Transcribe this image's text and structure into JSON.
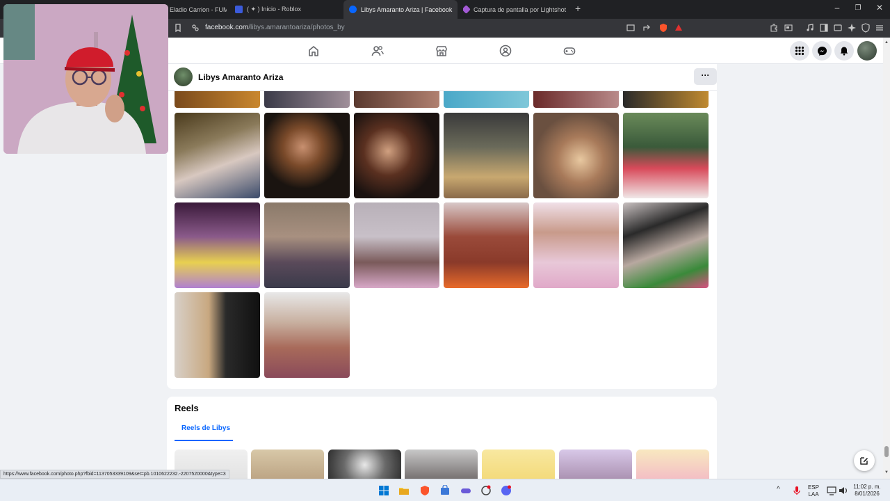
{
  "browser": {
    "tabs": [
      {
        "title": "Eladio Carrion - FUM",
        "active": false
      },
      {
        "title": "( ✦ ) Inicio - Roblox",
        "active": false
      },
      {
        "title": "Libys Amaranto Ariza | Facebook",
        "active": true
      },
      {
        "title": "Captura de pantalla por Lightshot",
        "active": false
      }
    ],
    "url_host": "facebook.com",
    "url_path": "/libys.amarantoariza/photos_by"
  },
  "profile": {
    "name": "Libys Amaranto Ariza",
    "more_label": "···"
  },
  "reels": {
    "section_title": "Reels",
    "tab_label": "Reels de Libys"
  },
  "status_url": "https://www.facebook.com/photo.php?fbid=1137053339109&set=pb.1010622232.-2207520000&type=3",
  "taskbar": {
    "lang_line1": "ESP",
    "lang_line2": "LAA",
    "time": "11:02 p. m.",
    "date": "8/01/2026"
  },
  "colors": {
    "fb_blue": "#0866ff",
    "page_bg": "#f0f2f5"
  }
}
